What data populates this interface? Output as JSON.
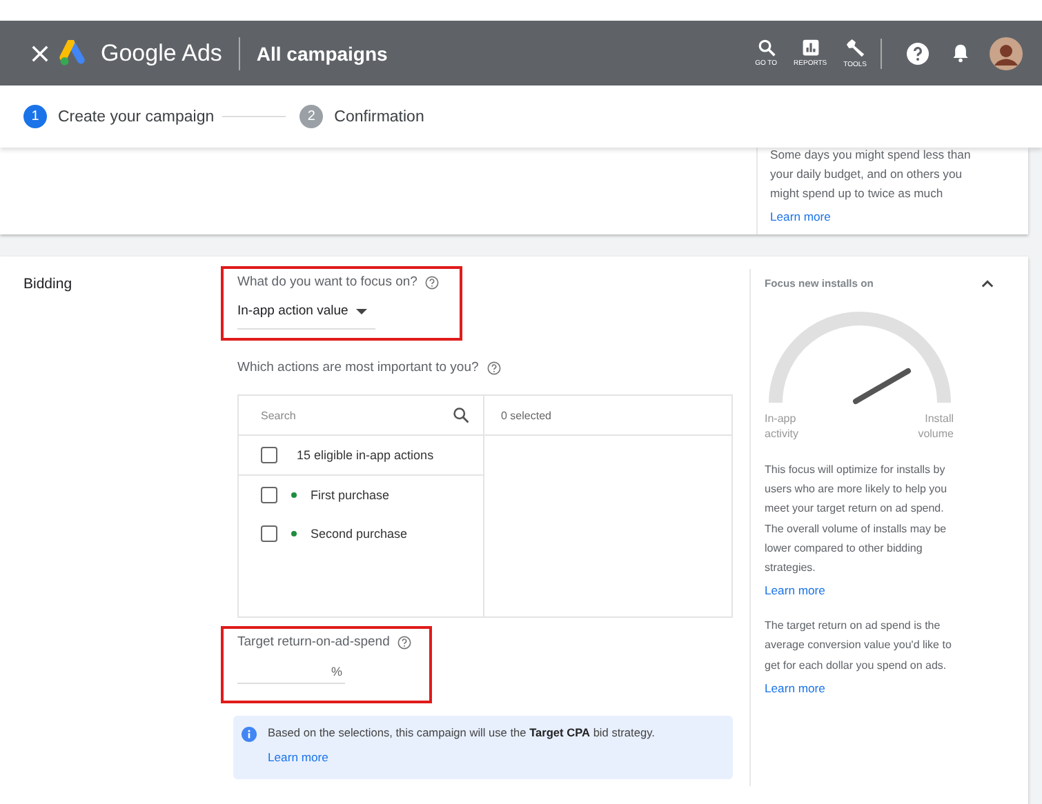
{
  "header": {
    "product": "Google Ads",
    "page_title": "All campaigns",
    "nav": [
      {
        "label": "GO TO",
        "kind": "search"
      },
      {
        "label": "REPORTS",
        "kind": "reports"
      },
      {
        "label": "TOOLS",
        "kind": "tools"
      }
    ]
  },
  "stepper": {
    "steps": [
      {
        "number": "1",
        "label": "Create your campaign",
        "selected": true
      },
      {
        "number": "2",
        "label": "Confirmation",
        "selected": false
      }
    ]
  },
  "budget_card": {
    "help_text": "Some days you might spend less than your daily budget, and on others you might spend up to twice as much",
    "link": "Learn more"
  },
  "bidding": {
    "label": "Bidding",
    "focus": {
      "question": "What do you want to focus on?",
      "value": "In-app action value",
      "highlighted": true
    },
    "actions": {
      "question": "Which actions are most important to you?",
      "search_placeholder": "Search",
      "selected_count": "0 selected",
      "items": [
        {
          "label": "15 eligible in-app actions",
          "checked": false,
          "kind": "group"
        },
        {
          "label": "First purchase",
          "checked": false,
          "kind": "action"
        },
        {
          "label": "Second purchase",
          "checked": false,
          "kind": "action"
        }
      ]
    },
    "target": {
      "label": "Target return-on-ad-spend",
      "suffix": "%",
      "highlighted": true
    },
    "info": {
      "text": "Based on the selections, this campaign will use the **Target CPA** bid strategy.",
      "link": "Learn more"
    },
    "side": {
      "title": "Focus new installs on",
      "expanded": true,
      "gauge_left": "In-app activity",
      "gauge_right": "Install volume",
      "paragraphs": [
        {
          "text": "This focus will optimize for installs by users who are more likely to help you meet your target return on ad spend. The overall volume of installs may be lower compared to other bidding strategies.",
          "link": "Learn more"
        },
        {
          "text": "The target return on ad spend is the average conversion value you'd like to get for each dollar you spend on ads.",
          "link": "Learn more"
        }
      ]
    }
  }
}
